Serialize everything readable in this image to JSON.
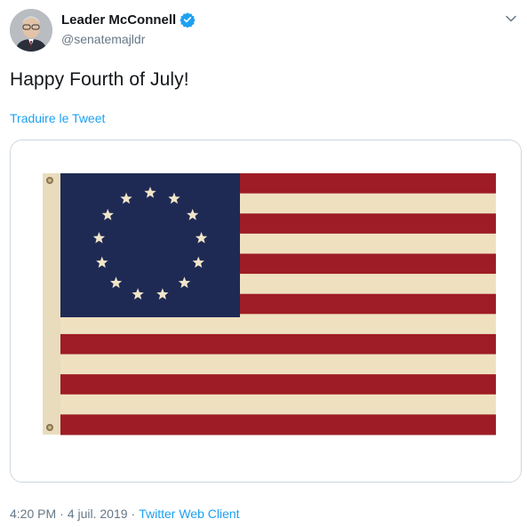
{
  "author": {
    "display_name": "Leader McConnell",
    "handle": "@senatemajldr",
    "verified": true
  },
  "tweet": {
    "text": "Happy Fourth of July!",
    "translate_label": "Traduire le Tweet"
  },
  "media": {
    "subject": "Betsy Ross flag",
    "stars": 13,
    "stripes": 13
  },
  "meta": {
    "time": "4:20 PM",
    "separator": "·",
    "date": "4 juil. 2019",
    "client": "Twitter Web Client"
  },
  "colors": {
    "link": "#1da1f2",
    "muted": "#657786",
    "verified_badge": "#1da1f2",
    "flag_red": "#9e1c25",
    "flag_cream": "#efe1bf",
    "flag_blue": "#1f2a54"
  },
  "icons": {
    "verified": "verified-badge-icon",
    "menu": "chevron-down-icon"
  }
}
